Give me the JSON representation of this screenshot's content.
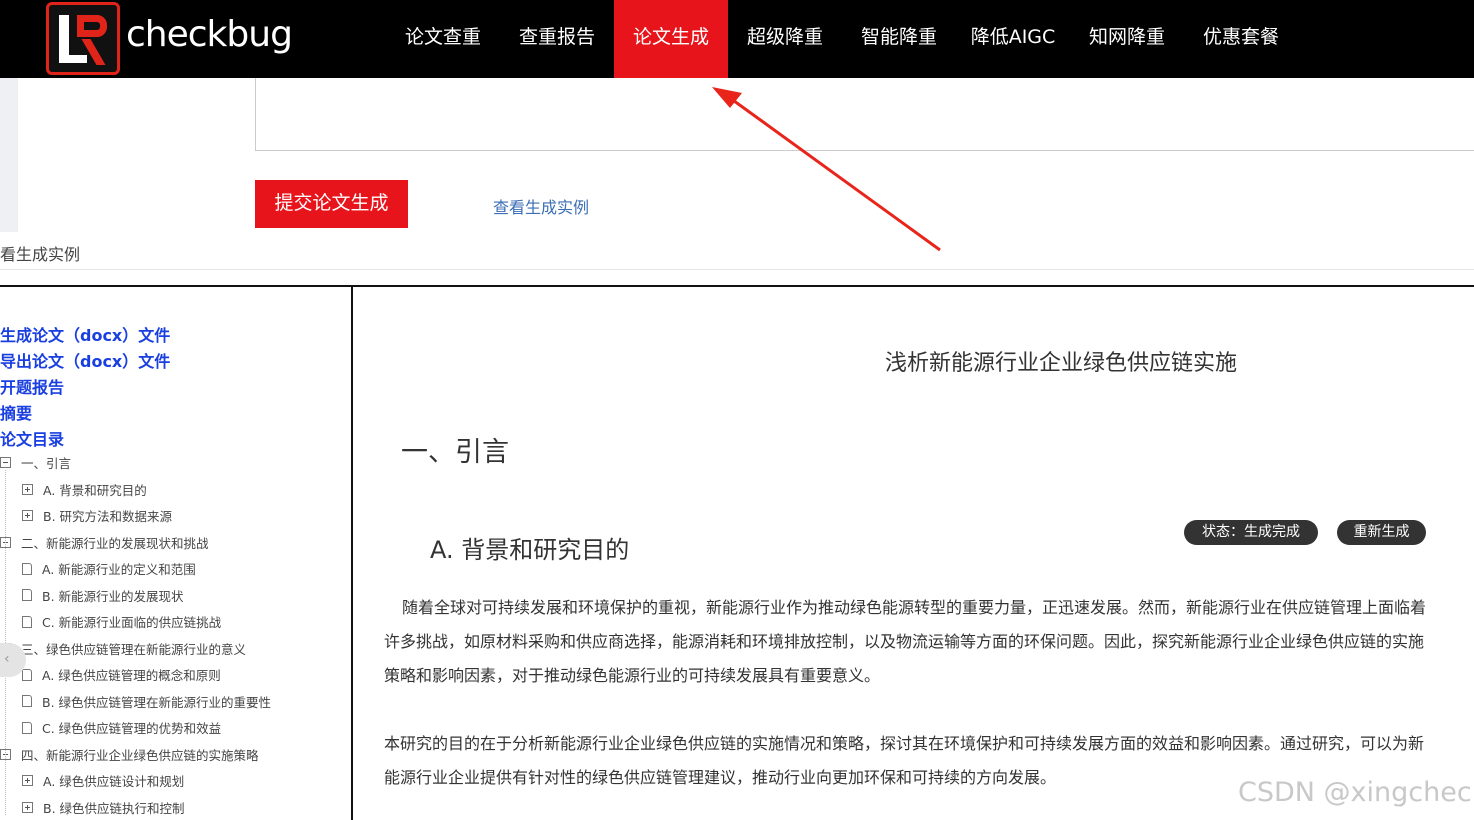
{
  "header": {
    "logo_text": "checkbug",
    "nav": [
      {
        "label": "论文查重",
        "active": false
      },
      {
        "label": "查重报告",
        "active": false
      },
      {
        "label": "论文生成",
        "active": true
      },
      {
        "label": "超级降重",
        "active": false
      },
      {
        "label": "智能降重",
        "active": false
      },
      {
        "label": "降低AIGC",
        "active": false
      },
      {
        "label": "知网降重",
        "active": false
      },
      {
        "label": "优惠套餐",
        "active": false
      }
    ]
  },
  "form": {
    "submit_label": "提交论文生成",
    "example_link": "查看生成实例"
  },
  "modal": {
    "title": "看生成实例"
  },
  "tree": {
    "links": [
      "生成论文（docx）文件",
      "导出论文（docx）文件",
      "开题报告",
      "摘要",
      "论文目录"
    ],
    "items": [
      {
        "label": "一、引言",
        "icon": "minus-box",
        "level": 0
      },
      {
        "label": "A. 背景和研究目的",
        "icon": "plus-box",
        "level": 1
      },
      {
        "label": "B. 研究方法和数据来源",
        "icon": "plus-box",
        "level": 1
      },
      {
        "label": "二、新能源行业的发展现状和挑战",
        "icon": "minus-box",
        "level": 0
      },
      {
        "label": "A. 新能源行业的定义和范围",
        "icon": "doc",
        "level": 1
      },
      {
        "label": "B. 新能源行业的发展现状",
        "icon": "doc",
        "level": 1
      },
      {
        "label": "C. 新能源行业面临的供应链挑战",
        "icon": "doc",
        "level": 1
      },
      {
        "label": "三、绿色供应链管理在新能源行业的意义",
        "icon": "minus-box",
        "level": 0
      },
      {
        "label": "A. 绿色供应链管理的概念和原则",
        "icon": "doc",
        "level": 1
      },
      {
        "label": "B. 绿色供应链管理在新能源行业的重要性",
        "icon": "doc",
        "level": 1
      },
      {
        "label": "C. 绿色供应链管理的优势和效益",
        "icon": "doc",
        "level": 1
      },
      {
        "label": "四、新能源行业企业绿色供应链的实施策略",
        "icon": "minus-box",
        "level": 0
      },
      {
        "label": "A. 绿色供应链设计和规划",
        "icon": "plus-box",
        "level": 1
      },
      {
        "label": "B. 绿色供应链执行和控制",
        "icon": "plus-box",
        "level": 1
      }
    ]
  },
  "document": {
    "title": "浅析新能源行业企业绿色供应链实施",
    "h1": "一、引言",
    "h2": "A. 背景和研究目的",
    "status_label": "状态：生成完成",
    "regen_label": "重新生成",
    "para1": "随着全球对可持续发展和环境保护的重视，新能源行业作为推动绿色能源转型的重要力量，正迅速发展。然而，新能源行业在供应链管理上面临着许多挑战，如原材料采购和供应商选择，能源消耗和环境排放控制，以及物流运输等方面的环保问题。因此，探究新能源行业企业绿色供应链的实施策略和影响因素，对于推动绿色能源行业的可持续发展具有重要意义。",
    "para2": "本研究的目的在于分析新能源行业企业绿色供应链的实施情况和策略，探讨其在环境保护和可持续发展方面的效益和影响因素。通过研究，可以为新能源行业企业提供有针对性的绿色供应链管理建议，推动行业向更加环保和可持续的方向发展。"
  },
  "watermark": "CSDN @xingcheck",
  "colors": {
    "brand_red": "#e8141b",
    "nav_bg": "#000000",
    "tree_link_blue": "#1a3fe0",
    "annotation_red": "#e8241b"
  }
}
